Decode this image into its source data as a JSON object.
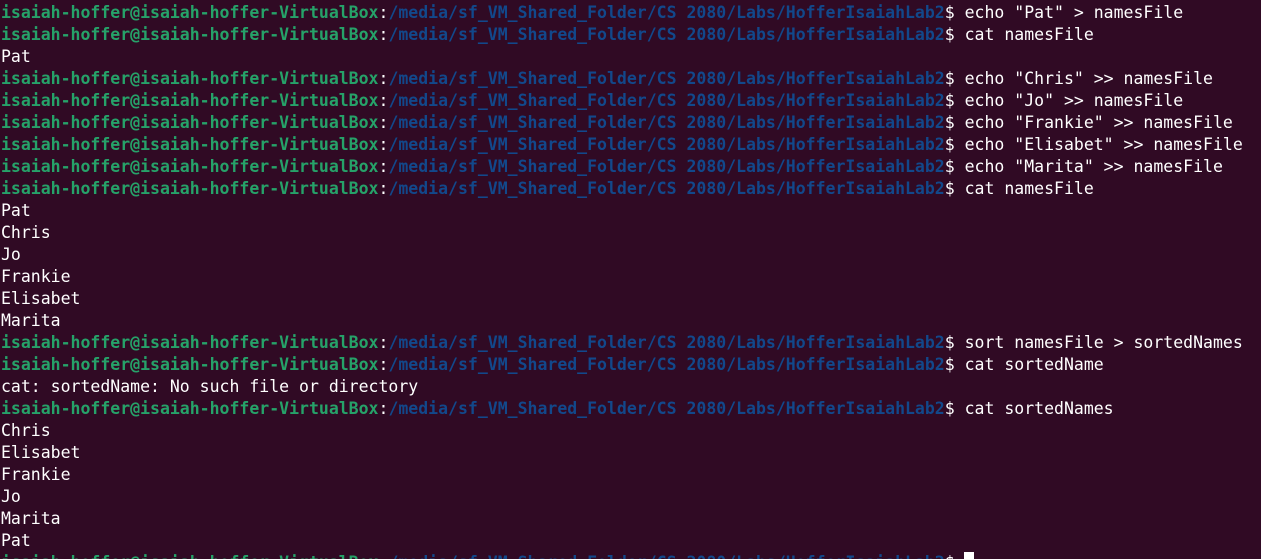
{
  "prompt": {
    "user_host": "isaiah-hoffer@isaiah-hoffer-VirtualBox",
    "separator": ":",
    "path": "/media/sf_VM_Shared_Folder/CS 2080/Labs/HofferIsaiahLab2",
    "symbol": "$"
  },
  "lines": [
    {
      "type": "cmd",
      "text": "echo \"Pat\" > namesFile"
    },
    {
      "type": "cmd",
      "text": "cat namesFile"
    },
    {
      "type": "out",
      "text": "Pat"
    },
    {
      "type": "cmd",
      "text": "echo \"Chris\" >> namesFile"
    },
    {
      "type": "cmd",
      "text": "echo \"Jo\" >> namesFile"
    },
    {
      "type": "cmd",
      "text": "echo \"Frankie\" >> namesFile"
    },
    {
      "type": "cmd",
      "text": "echo \"Elisabet\" >> namesFile"
    },
    {
      "type": "cmd",
      "text": "echo \"Marita\" >> namesFile"
    },
    {
      "type": "cmd",
      "text": "cat namesFile"
    },
    {
      "type": "out",
      "text": "Pat"
    },
    {
      "type": "out",
      "text": "Chris"
    },
    {
      "type": "out",
      "text": "Jo"
    },
    {
      "type": "out",
      "text": "Frankie"
    },
    {
      "type": "out",
      "text": "Elisabet"
    },
    {
      "type": "out",
      "text": "Marita"
    },
    {
      "type": "cmd",
      "text": "sort namesFile > sortedNames"
    },
    {
      "type": "cmd",
      "text": "cat sortedName"
    },
    {
      "type": "out",
      "text": "cat: sortedName: No such file or directory"
    },
    {
      "type": "cmd",
      "text": "cat sortedNames"
    },
    {
      "type": "out",
      "text": "Chris"
    },
    {
      "type": "out",
      "text": "Elisabet"
    },
    {
      "type": "out",
      "text": "Frankie"
    },
    {
      "type": "out",
      "text": "Jo"
    },
    {
      "type": "out",
      "text": "Marita"
    },
    {
      "type": "out",
      "text": "Pat"
    },
    {
      "type": "prompt",
      "text": ""
    }
  ],
  "colors": {
    "background": "#300a24",
    "user_host": "#26a269",
    "path": "#12488b",
    "text": "#ffffff"
  }
}
